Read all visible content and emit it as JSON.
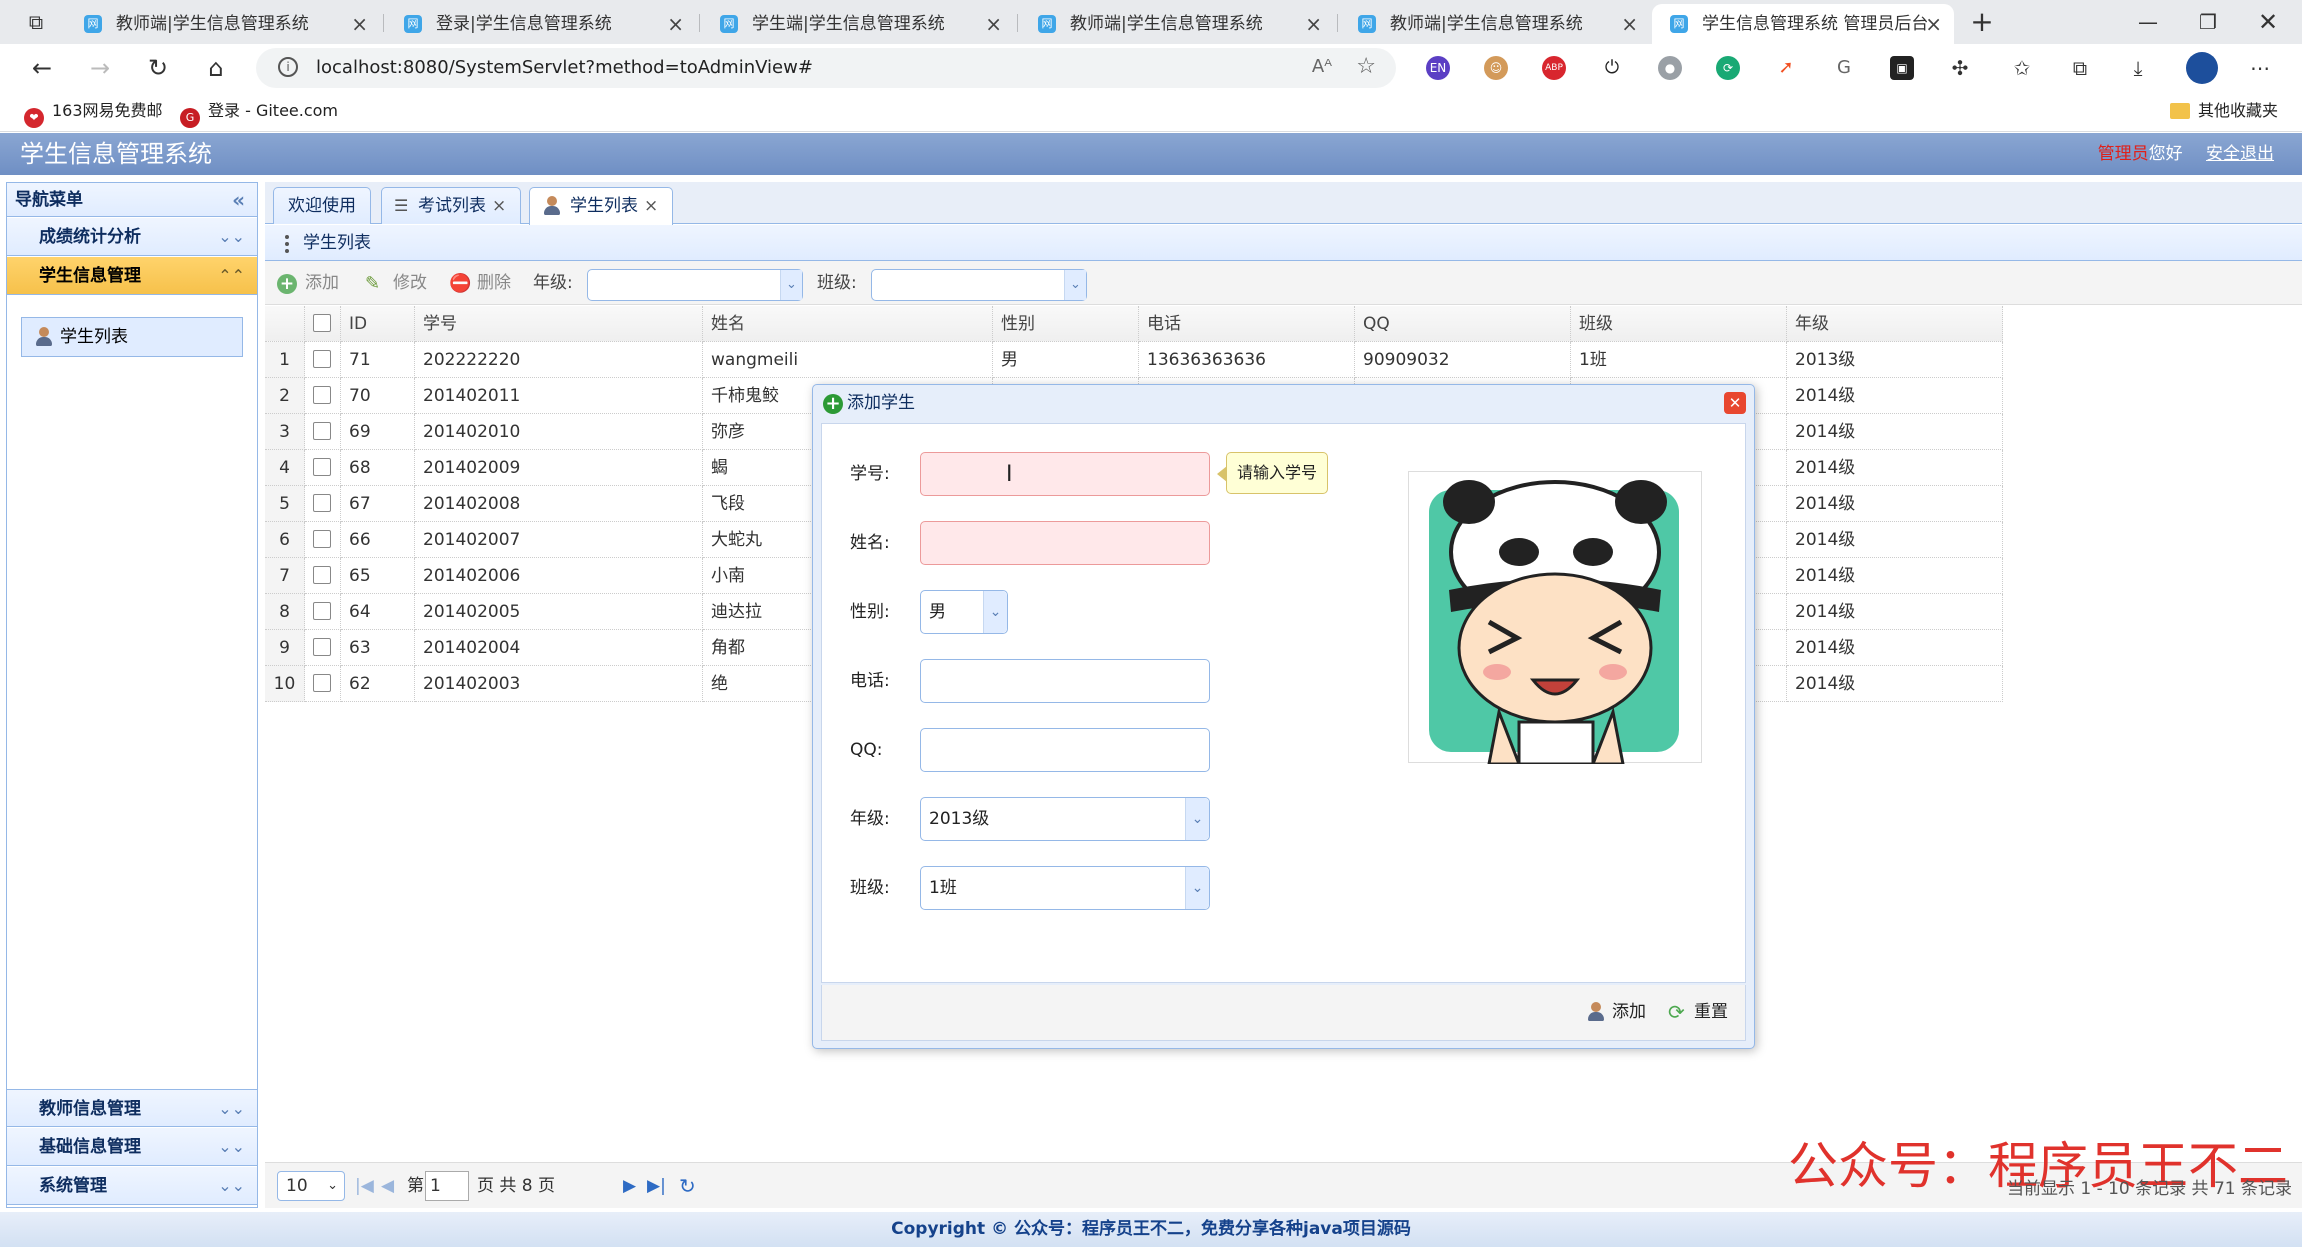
{
  "browser": {
    "tabs": [
      {
        "title": "教师端|学生信息管理系统"
      },
      {
        "title": "登录|学生信息管理系统"
      },
      {
        "title": "学生端|学生信息管理系统"
      },
      {
        "title": "教师端|学生信息管理系统"
      },
      {
        "title": "教师端|学生信息管理系统"
      },
      {
        "title": "学生信息管理系统 管理员后台",
        "active": true
      }
    ],
    "url": "localhost:8080/SystemServlet?method=toAdminView#",
    "bookmarks": [
      {
        "label": "163网易免费邮",
        "icon": "163-mail-icon"
      },
      {
        "label": "登录 - Gitee.com",
        "icon": "gitee-icon"
      }
    ],
    "other_bookmarks": "其他收藏夹"
  },
  "app": {
    "title": "学生信息管理系统",
    "role": "管理员",
    "greeting": "您好",
    "logout": "安全退出"
  },
  "sidebar": {
    "header": "导航菜单",
    "sections": [
      {
        "label": "成绩统计分析"
      },
      {
        "label": "学生信息管理",
        "selected": true
      },
      {
        "label": "教师信息管理"
      },
      {
        "label": "基础信息管理"
      },
      {
        "label": "系统管理"
      }
    ],
    "active_item": "学生列表"
  },
  "main": {
    "tabs": [
      {
        "label": "欢迎使用"
      },
      {
        "label": "考试列表",
        "close": "×"
      },
      {
        "label": "学生列表",
        "close": "×",
        "active": true
      }
    ],
    "panel_title": "学生列表",
    "toolbar": {
      "add": "添加",
      "edit": "修改",
      "delete": "删除",
      "grade_label": "年级:",
      "class_label": "班级:"
    },
    "table": {
      "columns": [
        "ID",
        "学号",
        "姓名",
        "性别",
        "电话",
        "QQ",
        "班级",
        "年级"
      ],
      "rows": [
        {
          "n": "1",
          "id": "71",
          "sno": "202222220",
          "name": "wangmeili",
          "sex": "男",
          "phone": "13636363636",
          "qq": "90909032",
          "cls": "1班",
          "grade": "2013级"
        },
        {
          "n": "2",
          "id": "70",
          "sno": "201402011",
          "name": "千柿鬼鲛",
          "sex": "",
          "phone": "",
          "qq": "",
          "cls": "",
          "grade": "2014级"
        },
        {
          "n": "3",
          "id": "69",
          "sno": "201402010",
          "name": "弥彦",
          "sex": "",
          "phone": "",
          "qq": "",
          "cls": "",
          "grade": "2014级"
        },
        {
          "n": "4",
          "id": "68",
          "sno": "201402009",
          "name": "蝎",
          "sex": "",
          "phone": "",
          "qq": "",
          "cls": "",
          "grade": "2014级"
        },
        {
          "n": "5",
          "id": "67",
          "sno": "201402008",
          "name": "飞段",
          "sex": "",
          "phone": "",
          "qq": "",
          "cls": "",
          "grade": "2014级"
        },
        {
          "n": "6",
          "id": "66",
          "sno": "201402007",
          "name": "大蛇丸",
          "sex": "",
          "phone": "",
          "qq": "",
          "cls": "",
          "grade": "2014级"
        },
        {
          "n": "7",
          "id": "65",
          "sno": "201402006",
          "name": "小南",
          "sex": "",
          "phone": "",
          "qq": "",
          "cls": "",
          "grade": "2014级"
        },
        {
          "n": "8",
          "id": "64",
          "sno": "201402005",
          "name": "迪达拉",
          "sex": "",
          "phone": "",
          "qq": "",
          "cls": "",
          "grade": "2014级"
        },
        {
          "n": "9",
          "id": "63",
          "sno": "201402004",
          "name": "角都",
          "sex": "",
          "phone": "",
          "qq": "",
          "cls": "",
          "grade": "2014级"
        },
        {
          "n": "10",
          "id": "62",
          "sno": "201402003",
          "name": "绝",
          "sex": "",
          "phone": "",
          "qq": "",
          "cls": "",
          "grade": "2014级"
        }
      ]
    },
    "pager": {
      "page_size": "10",
      "page_prefix": "第",
      "page_value": "1",
      "page_suffix": "页 共 8 页",
      "info": "当前显示 1 - 10 条记录 共 71 条记录"
    }
  },
  "dialog": {
    "title": "添加学生",
    "fields": {
      "sno_label": "学号:",
      "name_label": "姓名:",
      "sex_label": "性别:",
      "sex_value": "男",
      "phone_label": "电话:",
      "qq_label": "QQ:",
      "grade_label": "年级:",
      "grade_value": "2013级",
      "class_label": "班级:",
      "class_value": "1班"
    },
    "tooltip": "请输入学号",
    "add_button": "添加",
    "reset_button": "重置"
  },
  "footer": "Copyright © 公众号：程序员王不二，免费分享各种java项目源码",
  "watermark": "公众号：程序员王不二"
}
